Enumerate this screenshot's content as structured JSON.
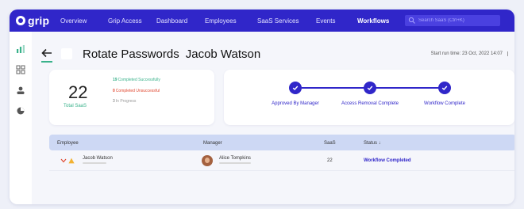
{
  "app": {
    "logo_text": "grip"
  },
  "nav": {
    "items": [
      "Overview",
      "Grip Access",
      "Dashboard",
      "Employees",
      "SaaS Services",
      "Events",
      "Workflows"
    ],
    "active": "Workflows",
    "search_placeholder": "Search SaaS (Ctrl+K)"
  },
  "sidebar": {
    "icons": [
      "bar-chart-icon",
      "grid-icon",
      "users-icon",
      "pie-chart-icon"
    ]
  },
  "page": {
    "title": "Rotate Passwords",
    "subtitle": "Jacob Watson",
    "start_time": "Start run time: 23 Oct, 2022 14:07"
  },
  "stats": {
    "total": "22",
    "total_label": "Total SaaS",
    "completed_count": "19",
    "completed_label": "Completed Successfully",
    "failed_count": "0",
    "failed_label": "Completed Unsuccessful",
    "progress_count": "3",
    "progress_label": "In Progress"
  },
  "steps": [
    {
      "label": "Approved By Manager"
    },
    {
      "label": "Access Removal Complete"
    },
    {
      "label": "Workflow Complete"
    }
  ],
  "table": {
    "headers": {
      "employee": "Employee",
      "manager": "Manager",
      "saas": "SaaS",
      "status": "Status ↓"
    },
    "rows": [
      {
        "employee": "Jacob Watson",
        "manager": "Alice Tompkins",
        "saas": "22",
        "status": "Workflow Completed"
      }
    ]
  },
  "colors": {
    "brand": "#3026c9",
    "success": "#3ab28b",
    "error": "#e0472f",
    "table_header": "#cdd8f4"
  }
}
